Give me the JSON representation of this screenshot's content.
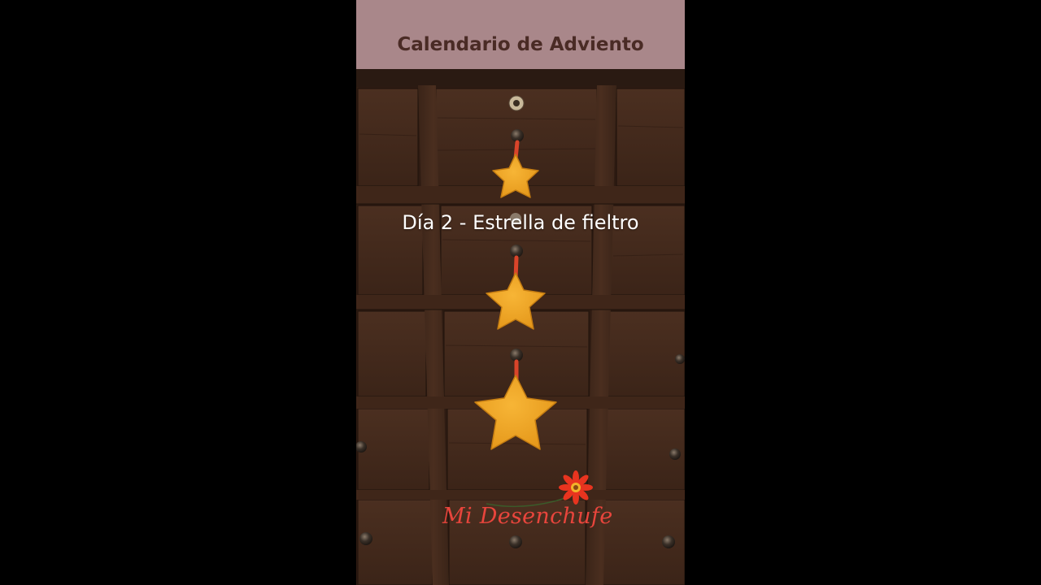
{
  "banner": {
    "title": "Calendario de Adviento"
  },
  "caption": {
    "text": "Día 2 - Estrella de fieltro"
  },
  "logo": {
    "text": "Mi Desenchufe"
  },
  "colors": {
    "background": "#000000",
    "banner": "#a9878a",
    "banner_text": "#4a2b25",
    "wood": "#3a2418",
    "star": "#f0a623",
    "ribbon": "#d9442a",
    "logo_text": "#e8453c",
    "flower": "#e8341f"
  }
}
